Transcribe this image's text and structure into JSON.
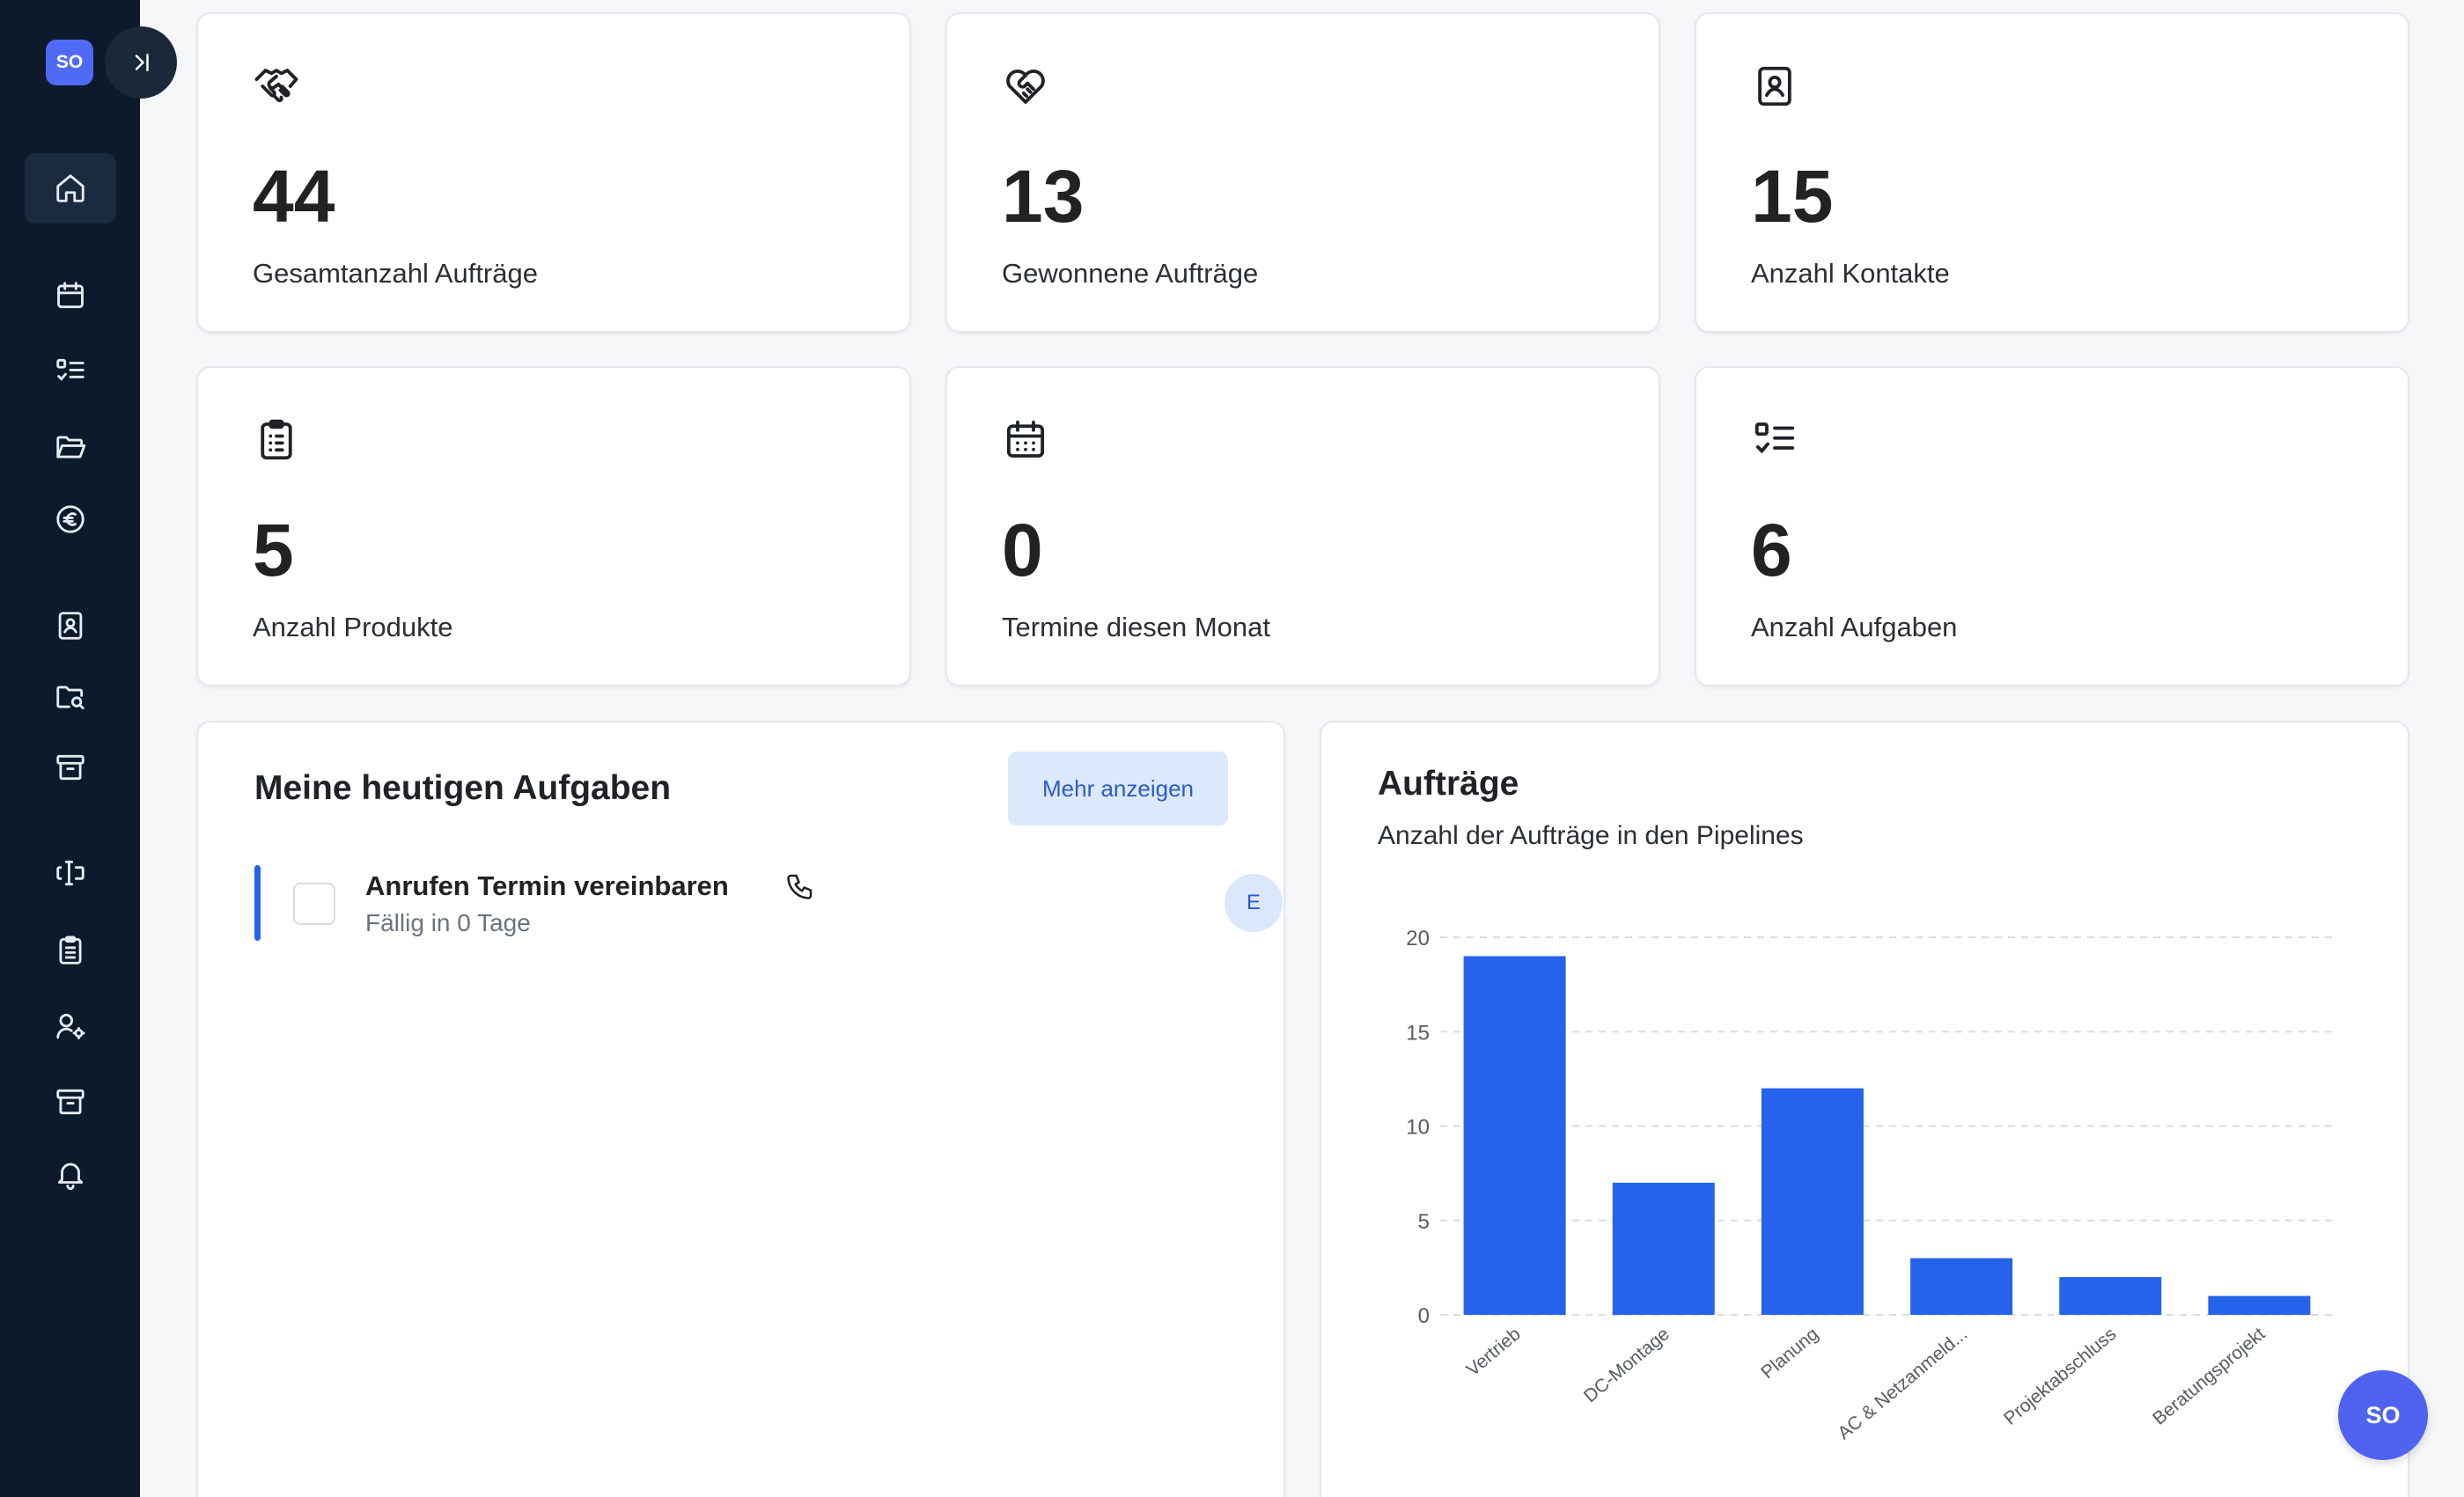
{
  "sidebar": {
    "logo_text": "SO",
    "items": [
      {
        "name": "home",
        "icon": "home-icon",
        "active": true
      },
      {
        "name": "calendar",
        "icon": "calendar-icon"
      },
      {
        "name": "tasks",
        "icon": "checklist-icon"
      },
      {
        "name": "projects",
        "icon": "folder-open-icon"
      },
      {
        "name": "finance",
        "icon": "euro-icon"
      },
      {
        "name": "contacts",
        "icon": "contact-book-icon"
      },
      {
        "name": "search-folder",
        "icon": "folder-search-icon"
      },
      {
        "name": "archive",
        "icon": "archive-icon"
      },
      {
        "name": "forms",
        "icon": "text-cursor-icon"
      },
      {
        "name": "clipboard",
        "icon": "clipboard-icon"
      },
      {
        "name": "user-settings",
        "icon": "user-cog-icon"
      },
      {
        "name": "archive-2",
        "icon": "archive-icon"
      },
      {
        "name": "notifications",
        "icon": "bell-icon"
      }
    ]
  },
  "stats": [
    {
      "value": "44",
      "label": "Gesamtanzahl Aufträge",
      "icon": "handshake-icon"
    },
    {
      "value": "13",
      "label": "Gewonnene Aufträge",
      "icon": "heart-handshake-icon"
    },
    {
      "value": "15",
      "label": "Anzahl Kontakte",
      "icon": "contact-book-icon"
    },
    {
      "value": "5",
      "label": "Anzahl Produkte",
      "icon": "clipboard-list-icon"
    },
    {
      "value": "0",
      "label": "Termine diesen Monat",
      "icon": "calendar-days-icon"
    },
    {
      "value": "6",
      "label": "Anzahl Aufgaben",
      "icon": "checklist-icon"
    }
  ],
  "tasks_panel": {
    "title": "Meine heutigen Aufgaben",
    "more_label": "Mehr anzeigen",
    "items": [
      {
        "title": "Anrufen Termin vereinbaren",
        "due": "Fällig in 0 Tage",
        "avatar": "E",
        "icon": "phone-icon"
      }
    ]
  },
  "chart_panel": {
    "title": "Aufträge",
    "subtitle": "Anzahl der Aufträge in den Pipelines"
  },
  "chart_data": {
    "type": "bar",
    "title": "Aufträge",
    "subtitle": "Anzahl der Aufträge in den Pipelines",
    "categories": [
      "Vertrieb",
      "DC-Montage",
      "Planung",
      "AC & Netzanmeld...",
      "Projektabschluss",
      "Beratungsprojekt"
    ],
    "values": [
      19,
      7,
      12,
      3,
      2,
      1
    ],
    "yticks": [
      "0",
      "5",
      "10",
      "15",
      "20"
    ],
    "ylim": [
      0,
      20
    ],
    "grid": true,
    "bar_color": "#2563eb"
  },
  "fab": {
    "label": "SO"
  },
  "colors": {
    "sidebar": "#0c1a2c",
    "accent": "#2563eb",
    "brand": "#4f6bf5"
  }
}
